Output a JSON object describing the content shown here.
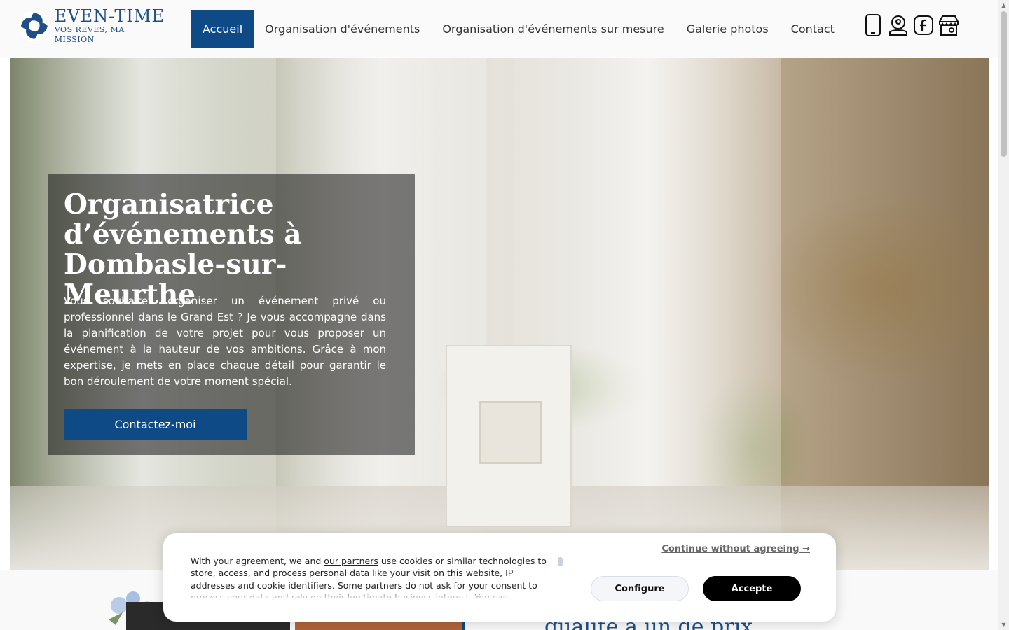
{
  "brand": {
    "name": "EVEN-TIME",
    "tagline": "VOS REVES, MA MISSION",
    "color": "#1e4f86"
  },
  "nav": {
    "items": [
      {
        "label": "Accueil",
        "active": true
      },
      {
        "label": "Organisation d'événements"
      },
      {
        "label": "Organisation d'événements sur mesure"
      },
      {
        "label": "Galerie photos"
      },
      {
        "label": "Contact"
      }
    ],
    "active_color": "#0e4a86"
  },
  "social": [
    "phone-icon",
    "location-icon",
    "facebook-icon",
    "store-icon"
  ],
  "hero": {
    "title": "Organisatrice d’événements à Dombasle-sur-Meurthe",
    "text": "Vous souhaitez organiser un événement privé ou professionnel dans le Grand Est ? Je vous accompagne dans la planification de votre projet pour vous proposer un événement à la hauteur de vos ambitions. Grâce à mon expertise, je mets en place chaque détail pour garantir le bon déroulement de votre moment spécial.",
    "button": "Contactez-moi"
  },
  "section": {
    "title_fragment": "qualité à un de prix"
  },
  "cookie": {
    "text_before": "With your agreement, we and ",
    "link": "our partners",
    "text_after": " use cookies or similar technologies to store, access, and process personal data like your visit on this website, IP addresses and cookie identifiers. Some partners do not ask for your consent to process your data and rely on their legitimate business interest. You can",
    "continue": "Continue without agreeing →",
    "configure": "Configure",
    "accept": "Accepte"
  }
}
